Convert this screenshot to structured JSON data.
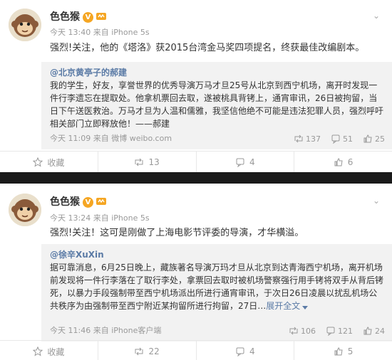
{
  "posts": [
    {
      "author": "色色猴",
      "time": "今天 13:40",
      "source_prefix": "来自",
      "source": "iPhone 5s",
      "text": "强烈!关注，他的《塔洛》获2015台湾金马奖四项提名，终获最佳改编剧本。",
      "repost": {
        "user": "@北京黄亭子的郝建",
        "text": "我的学生，好友，享誉世界的优秀导演万马才旦25号从北京到西宁机场，离开时发现一件行李遗忘在提取处。他拿机票回去取，遂被桃具背铐上，通宵审讯，26日被拘留，当日下午送医救治。万马才旦为人温和儒雅，我坚信他绝不可能是违法犯罪人员，强烈呼吁相关部门立即释放他！——郝建",
        "time": "今天 11:09",
        "source_prefix": "来自",
        "source": "微博 weibo.com",
        "repost_count": "137",
        "comment_count": "51",
        "like_count": "25"
      },
      "actions": {
        "collect": "收藏",
        "repost": "13",
        "comment": "4",
        "like": "6"
      }
    },
    {
      "author": "色色猴",
      "time": "今天 13:24",
      "source_prefix": "来自",
      "source": "iPhone 5s",
      "text": "强烈!关注！这可是刚做了上海电影节评委的导演，才华横溢。",
      "repost": {
        "user": "@徐辛XuXin",
        "text": "据可靠消息，6月25日晚上，藏族著名导演万玛才旦从北京到达青海西宁机场，离开机场前发现将一件行李落在了取行李处，拿票回去取时被机场警察强行用手铐将双手从背后铐死，以暴力手段强制带至西宁机场派出所进行通宵审讯，于次日26日凌晨以扰乱机场公共秩序为由强制带至西宁附近某拘留所进行拘留，27日…",
        "expand": "展开全文",
        "time": "今天 11:46",
        "source_prefix": "来自",
        "source": "iPhone客户端",
        "repost_count": "106",
        "comment_count": "121",
        "like_count": "24"
      },
      "actions": {
        "collect": "收藏",
        "repost": "22",
        "comment": "4",
        "like": "5"
      }
    }
  ],
  "colors": {
    "link": "#5b7ba6",
    "meta": "#999999",
    "badge": "#f5a623",
    "repost_bg": "#f2f2f2",
    "separator": "#1a1a1a"
  }
}
